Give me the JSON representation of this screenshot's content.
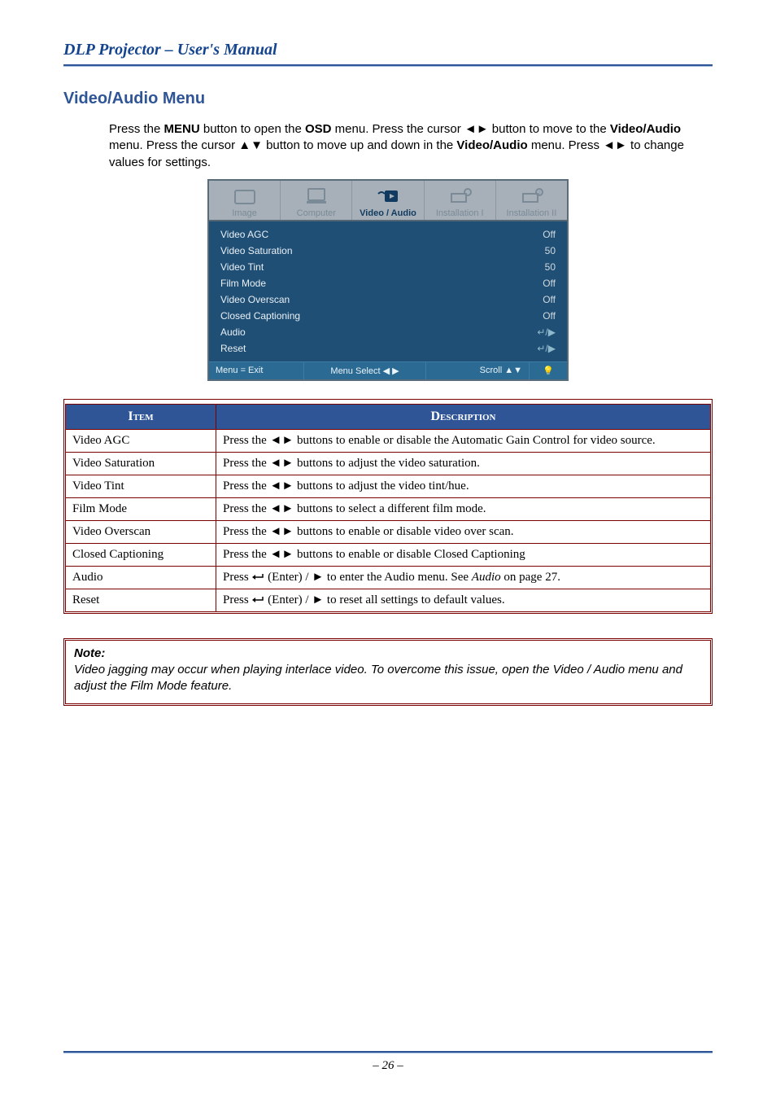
{
  "header": {
    "title": "DLP Projector – User's Manual"
  },
  "section": {
    "title": "Video/Audio Menu"
  },
  "intro": {
    "line1_pre": "Press the ",
    "menu_b": "MENU",
    "line1_mid": " button to open the ",
    "osd_b": "OSD",
    "line1_post": " menu. Press the cursor ◄► button to move to the ",
    "va_b": "Video/Audio",
    "line2_a": " menu. Press the cursor ▲▼ button to move up and down in the ",
    "va_b2": "Video/Audio",
    "line2_b": " menu. Press ◄► to change values for settings."
  },
  "osd": {
    "tabs": {
      "image": "Image",
      "computer": "Computer",
      "video_audio": "Video / Audio",
      "install1": "Installation I",
      "install2": "Installation II"
    },
    "rows": [
      {
        "label": "Video AGC",
        "value": "Off"
      },
      {
        "label": "Video Saturation",
        "value": "50"
      },
      {
        "label": "Video Tint",
        "value": "50"
      },
      {
        "label": "Film Mode",
        "value": "Off"
      },
      {
        "label": "Video Overscan",
        "value": "Off"
      },
      {
        "label": "Closed Captioning",
        "value": "Off"
      },
      {
        "label": "Audio",
        "value": "↵/▶"
      },
      {
        "label": "Reset",
        "value": "↵/▶"
      }
    ],
    "footer": {
      "exit": "Menu = Exit",
      "select": "Menu Select ◀ ▶",
      "scroll": "Scroll ▲▼",
      "help": "💡"
    }
  },
  "table": {
    "head_item": "Item",
    "head_desc": "Description",
    "rows": [
      {
        "item": "Video AGC",
        "desc_pre": "Press the ◄► buttons to enable or disable the Automatic Gain Control for video source.",
        "desc_post": ""
      },
      {
        "item": "Video Saturation",
        "desc_pre": "Press the ◄► buttons to adjust the video saturation.",
        "desc_post": ""
      },
      {
        "item": "Video Tint",
        "desc_pre": "Press the ◄► buttons to adjust the video tint/hue.",
        "desc_post": ""
      },
      {
        "item": "Film Mode",
        "desc_pre": "Press the ◄► buttons to select a different film mode.",
        "desc_post": ""
      },
      {
        "item": "Video Overscan",
        "desc_pre": "Press the ◄► buttons to enable or disable video over scan.",
        "desc_post": ""
      },
      {
        "item": "Closed Captioning",
        "desc_pre": "Press the ◄► buttons to enable or disable Closed Captioning",
        "desc_post": ""
      },
      {
        "item": "Audio",
        "desc_pre": "Press ",
        "enter": "(Enter) / ► to enter the Audio menu. See ",
        "audio_i": "Audio",
        "desc_post": " on page 27."
      },
      {
        "item": "Reset",
        "desc_pre": "Press ",
        "enter": "(Enter) / ► to reset all settings to default values.",
        "desc_post": ""
      }
    ]
  },
  "note": {
    "label": "Note:",
    "body": "Video jagging may occur when playing interlace video. To overcome this issue, open the Video / Audio menu and adjust the Film Mode feature."
  },
  "footer": {
    "page": "– 26 –"
  }
}
